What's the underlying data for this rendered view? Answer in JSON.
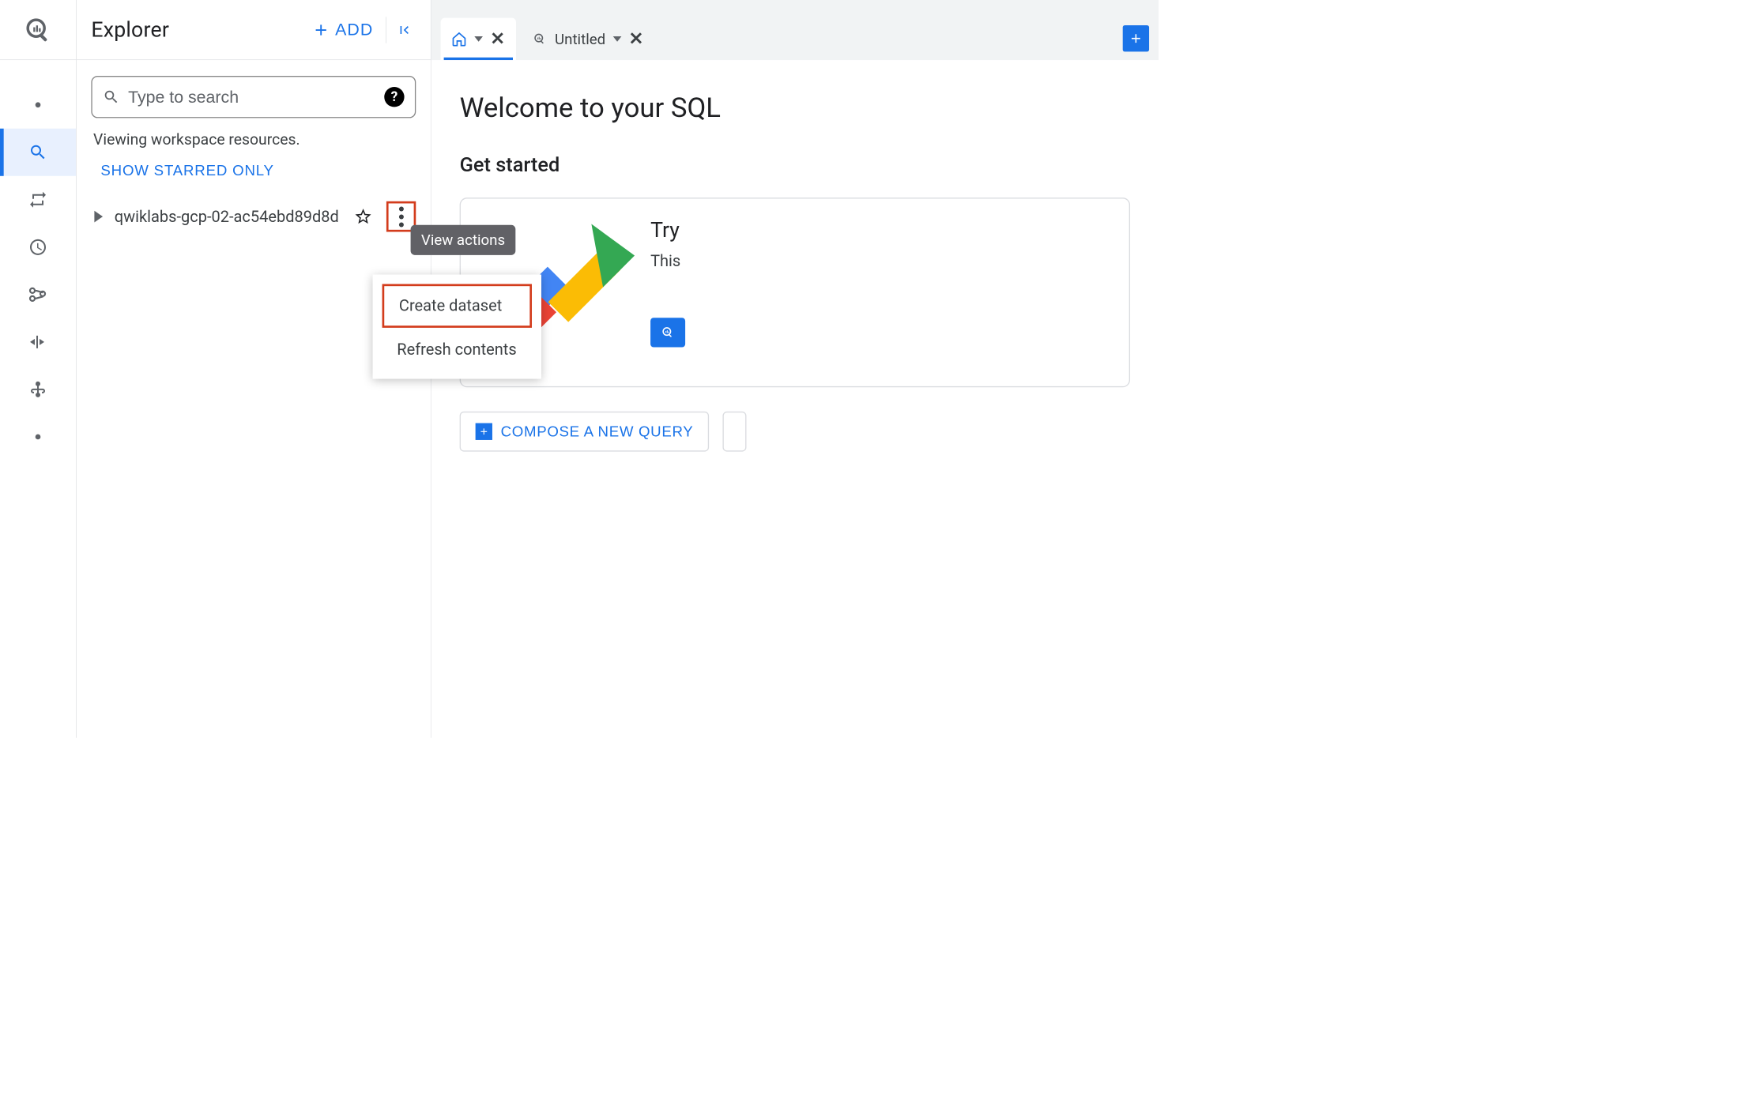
{
  "explorer": {
    "title": "Explorer",
    "add_label": "ADD",
    "search_placeholder": "Type to search",
    "viewing_text": "Viewing workspace resources.",
    "show_starred_label": "SHOW STARRED ONLY",
    "project_name": "qwiklabs-gcp-02-ac54ebd89d8d"
  },
  "tooltip": {
    "view_actions": "View actions"
  },
  "dropdown": {
    "create_dataset": "Create dataset",
    "refresh_contents": "Refresh contents"
  },
  "tabs": {
    "untitled_label": "Untitled"
  },
  "main": {
    "welcome": "Welcome to your SQL",
    "get_started": "Get started",
    "card_title": "Try",
    "card_sub": "This",
    "compose_label": "COMPOSE A NEW QUERY"
  }
}
